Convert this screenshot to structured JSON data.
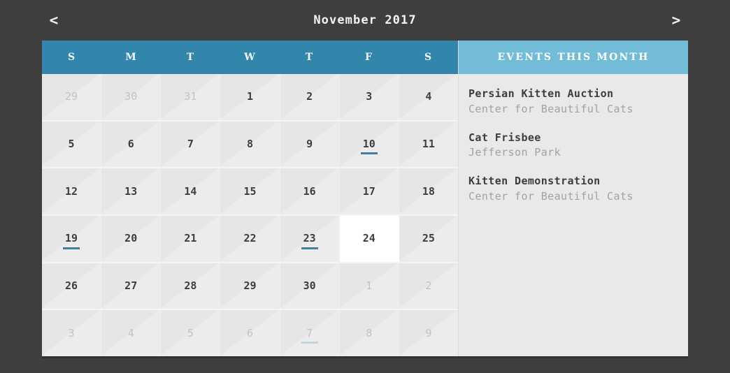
{
  "nav": {
    "prev_label": "<",
    "next_label": ">",
    "title": "November 2017"
  },
  "calendar": {
    "weekdays": [
      "S",
      "M",
      "T",
      "W",
      "T",
      "F",
      "S"
    ],
    "weeks": [
      [
        {
          "num": "29",
          "muted": true,
          "event": false,
          "selected": false
        },
        {
          "num": "30",
          "muted": true,
          "event": false,
          "selected": false
        },
        {
          "num": "31",
          "muted": true,
          "event": false,
          "selected": false
        },
        {
          "num": "1",
          "muted": false,
          "event": false,
          "selected": false
        },
        {
          "num": "2",
          "muted": false,
          "event": false,
          "selected": false
        },
        {
          "num": "3",
          "muted": false,
          "event": false,
          "selected": false
        },
        {
          "num": "4",
          "muted": false,
          "event": false,
          "selected": false
        }
      ],
      [
        {
          "num": "5",
          "muted": false,
          "event": false,
          "selected": false
        },
        {
          "num": "6",
          "muted": false,
          "event": false,
          "selected": false
        },
        {
          "num": "7",
          "muted": false,
          "event": false,
          "selected": false
        },
        {
          "num": "8",
          "muted": false,
          "event": false,
          "selected": false
        },
        {
          "num": "9",
          "muted": false,
          "event": false,
          "selected": false
        },
        {
          "num": "10",
          "muted": false,
          "event": true,
          "selected": false
        },
        {
          "num": "11",
          "muted": false,
          "event": false,
          "selected": false
        }
      ],
      [
        {
          "num": "12",
          "muted": false,
          "event": false,
          "selected": false
        },
        {
          "num": "13",
          "muted": false,
          "event": false,
          "selected": false
        },
        {
          "num": "14",
          "muted": false,
          "event": false,
          "selected": false
        },
        {
          "num": "15",
          "muted": false,
          "event": false,
          "selected": false
        },
        {
          "num": "16",
          "muted": false,
          "event": false,
          "selected": false
        },
        {
          "num": "17",
          "muted": false,
          "event": false,
          "selected": false
        },
        {
          "num": "18",
          "muted": false,
          "event": false,
          "selected": false
        }
      ],
      [
        {
          "num": "19",
          "muted": false,
          "event": true,
          "selected": false
        },
        {
          "num": "20",
          "muted": false,
          "event": false,
          "selected": false
        },
        {
          "num": "21",
          "muted": false,
          "event": false,
          "selected": false
        },
        {
          "num": "22",
          "muted": false,
          "event": false,
          "selected": false
        },
        {
          "num": "23",
          "muted": false,
          "event": true,
          "selected": false
        },
        {
          "num": "24",
          "muted": false,
          "event": false,
          "selected": true
        },
        {
          "num": "25",
          "muted": false,
          "event": false,
          "selected": false
        }
      ],
      [
        {
          "num": "26",
          "muted": false,
          "event": false,
          "selected": false
        },
        {
          "num": "27",
          "muted": false,
          "event": false,
          "selected": false
        },
        {
          "num": "28",
          "muted": false,
          "event": false,
          "selected": false
        },
        {
          "num": "29",
          "muted": false,
          "event": false,
          "selected": false
        },
        {
          "num": "30",
          "muted": false,
          "event": false,
          "selected": false
        },
        {
          "num": "1",
          "muted": true,
          "event": false,
          "selected": false
        },
        {
          "num": "2",
          "muted": true,
          "event": false,
          "selected": false
        }
      ],
      [
        {
          "num": "3",
          "muted": true,
          "event": false,
          "selected": false
        },
        {
          "num": "4",
          "muted": true,
          "event": false,
          "selected": false
        },
        {
          "num": "5",
          "muted": true,
          "event": false,
          "selected": false
        },
        {
          "num": "6",
          "muted": true,
          "event": false,
          "selected": false
        },
        {
          "num": "7",
          "muted": true,
          "event": true,
          "selected": false
        },
        {
          "num": "8",
          "muted": true,
          "event": false,
          "selected": false
        },
        {
          "num": "9",
          "muted": true,
          "event": false,
          "selected": false
        }
      ]
    ]
  },
  "events_panel": {
    "header": "EVENTS THIS MONTH",
    "items": [
      {
        "title": "Persian Kitten Auction",
        "venue": "Center for Beautiful Cats"
      },
      {
        "title": "Cat Frisbee",
        "venue": "Jefferson Park"
      },
      {
        "title": "Kitten Demonstration",
        "venue": "Center for Beautiful Cats"
      }
    ]
  },
  "colors": {
    "page_background": "#3e3e3e",
    "weekday_header": "#3286ab",
    "events_header": "#72bcd8",
    "cell_background": "#e9e9e9",
    "selected_cell": "#ffffff",
    "event_marker": "#41809c",
    "day_text": "#3d3d3d",
    "muted_day_text": "#c2c2c2",
    "venue_text": "#a2a2a2"
  }
}
